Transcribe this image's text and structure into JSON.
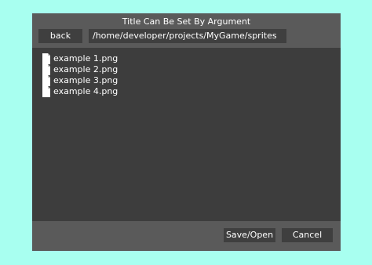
{
  "dialog": {
    "title": "Title Can Be Set By Argument"
  },
  "toolbar": {
    "back_label": "back",
    "path": "/home/developer/projects/MyGame/sprites"
  },
  "files": [
    {
      "name": "example 1.png",
      "icon": "file-icon"
    },
    {
      "name": "example 2.png",
      "icon": "file-icon"
    },
    {
      "name": "example 3.png",
      "icon": "file-icon"
    },
    {
      "name": "example 4.png",
      "icon": "file-icon"
    }
  ],
  "footer": {
    "save_label": "Save/Open",
    "cancel_label": "Cancel"
  },
  "colors": {
    "background": "#a8fff0",
    "dialog": "#5a5a5a",
    "panel": "#3d3d3d",
    "text": "#ffffff"
  }
}
